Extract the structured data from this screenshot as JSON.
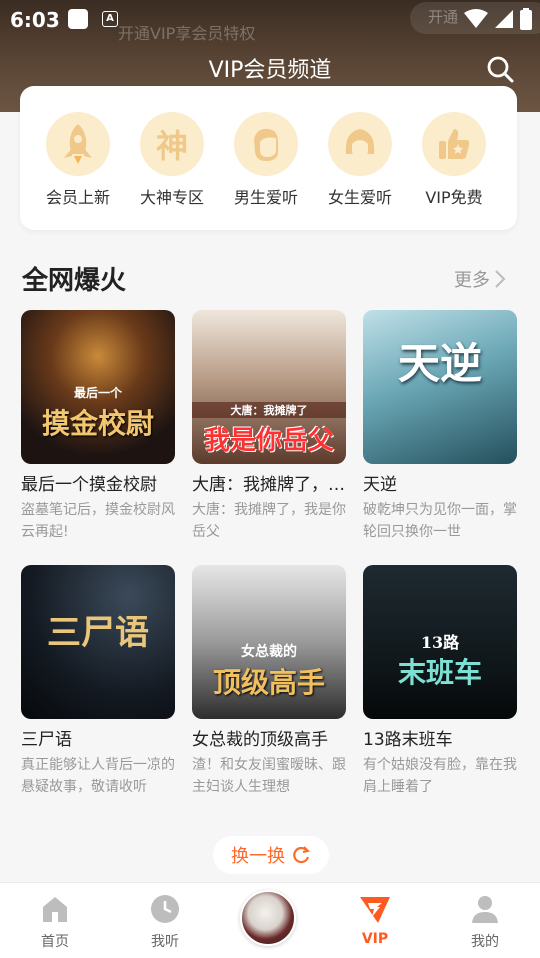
{
  "status_bar": {
    "time": "6:03"
  },
  "header": {
    "title": "VIP会员频道",
    "ghost_text": "开通VIP享会员特权",
    "ghost_button": "开通"
  },
  "categories": [
    {
      "label": "会员上新",
      "icon": "rocket-icon"
    },
    {
      "label": "大神专区",
      "icon": "shen-character-icon",
      "glyph": "神"
    },
    {
      "label": "男生爱听",
      "icon": "male-face-icon"
    },
    {
      "label": "女生爱听",
      "icon": "female-face-icon"
    },
    {
      "label": "VIP免费",
      "icon": "thumbs-up-icon"
    }
  ],
  "section": {
    "title": "全网爆火",
    "more_label": "更多"
  },
  "books": [
    {
      "title": "最后一个摸金校尉",
      "desc": "盗墓笔记后，摸金校尉风云再起!",
      "cover_text": "摸金校尉",
      "cover_sub": "最后一个"
    },
    {
      "title": "大唐：我摊牌了，我是你岳父",
      "desc": "大唐：我摊牌了，我是你岳父",
      "cover_text": "我是你岳父",
      "cover_sub": "大唐：我摊牌了"
    },
    {
      "title": "天逆",
      "desc": "破乾坤只为见你一面，掌轮回只换你一世",
      "cover_text": "天逆",
      "cover_sub": ""
    },
    {
      "title": "三尸语",
      "desc": "真正能够让人背后一凉的悬疑故事，敬请收听",
      "cover_text": "三尸语",
      "cover_sub": ""
    },
    {
      "title": "女总裁的顶级高手",
      "desc": "渣！和女友闺蜜暧昧、跟主妇谈人生理想",
      "cover_text": "顶级高手",
      "cover_sub": "女总裁的"
    },
    {
      "title": "13路末班车",
      "desc": "有个姑娘没有脸，靠在我肩上睡着了",
      "cover_text": "末班车",
      "cover_sub": "13路"
    }
  ],
  "refresh_label": "换一换",
  "tabs": [
    {
      "label": "首页",
      "icon": "home-icon"
    },
    {
      "label": "我听",
      "icon": "clock-icon"
    },
    {
      "label": "VIP",
      "icon": "vip-logo-icon",
      "active": true
    },
    {
      "label": "我的",
      "icon": "profile-icon"
    }
  ],
  "colors": {
    "accent": "#ff5a1f",
    "category_bg": "#fbeccc",
    "category_icon": "#f0c98a"
  }
}
